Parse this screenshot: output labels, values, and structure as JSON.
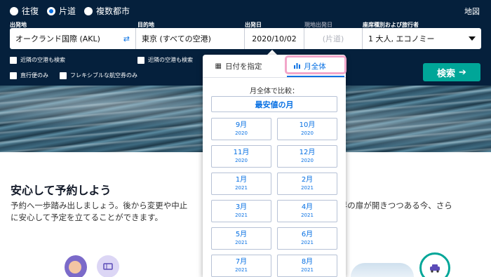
{
  "trip_type": {
    "options": [
      "往復",
      "片道",
      "複数都市"
    ],
    "selected": "片道"
  },
  "map_link": "地図",
  "labels": {
    "from": "出発地",
    "to": "目的地",
    "depart": "出発日",
    "return": "現地出発日",
    "cabin": "座席種別および旅行者"
  },
  "values": {
    "from": "オークランド国際 (AKL)",
    "to": "東京 (すべての空港)",
    "depart": "2020/10/02",
    "return_placeholder": "(片道)",
    "cabin": "1 大人, エコノミー"
  },
  "checkboxes": {
    "nearby_from": "近隣の空港も検索",
    "nearby_to": "近隣の空港も検索",
    "direct_only": "直行便のみ",
    "flexible": "フレキシブルな航空券のみ"
  },
  "search_button": "検索",
  "calendar": {
    "tab_specific": "日付を指定",
    "tab_whole_month": "月全体",
    "active_tab": "月全体",
    "compare_label": "月全体で比較：",
    "cheapest_button": "最安値の月",
    "months": [
      {
        "month": "9月",
        "year": "2020"
      },
      {
        "month": "10月",
        "year": "2020"
      },
      {
        "month": "11月",
        "year": "2020"
      },
      {
        "month": "12月",
        "year": "2020"
      },
      {
        "month": "1月",
        "year": "2021"
      },
      {
        "month": "2月",
        "year": "2021"
      },
      {
        "month": "3月",
        "year": "2021"
      },
      {
        "month": "4月",
        "year": "2021"
      },
      {
        "month": "5月",
        "year": "2021"
      },
      {
        "month": "6月",
        "year": "2021"
      },
      {
        "month": "7月",
        "year": "2021"
      },
      {
        "month": "8月",
        "year": "2021"
      }
    ]
  },
  "content": {
    "headline": "安心して予約しよう",
    "body_line1_left": "予約へ一歩踏み出しましょう。後から変更や中止",
    "body_line1_right": "世界の扉が開きつつある今、さら",
    "body_line2": "に安心して予定を立てることができます。"
  },
  "colors": {
    "topbar": "#05203c",
    "accent": "#0770e3",
    "search_button": "#00a698",
    "highlight": "#f2a6c9"
  }
}
